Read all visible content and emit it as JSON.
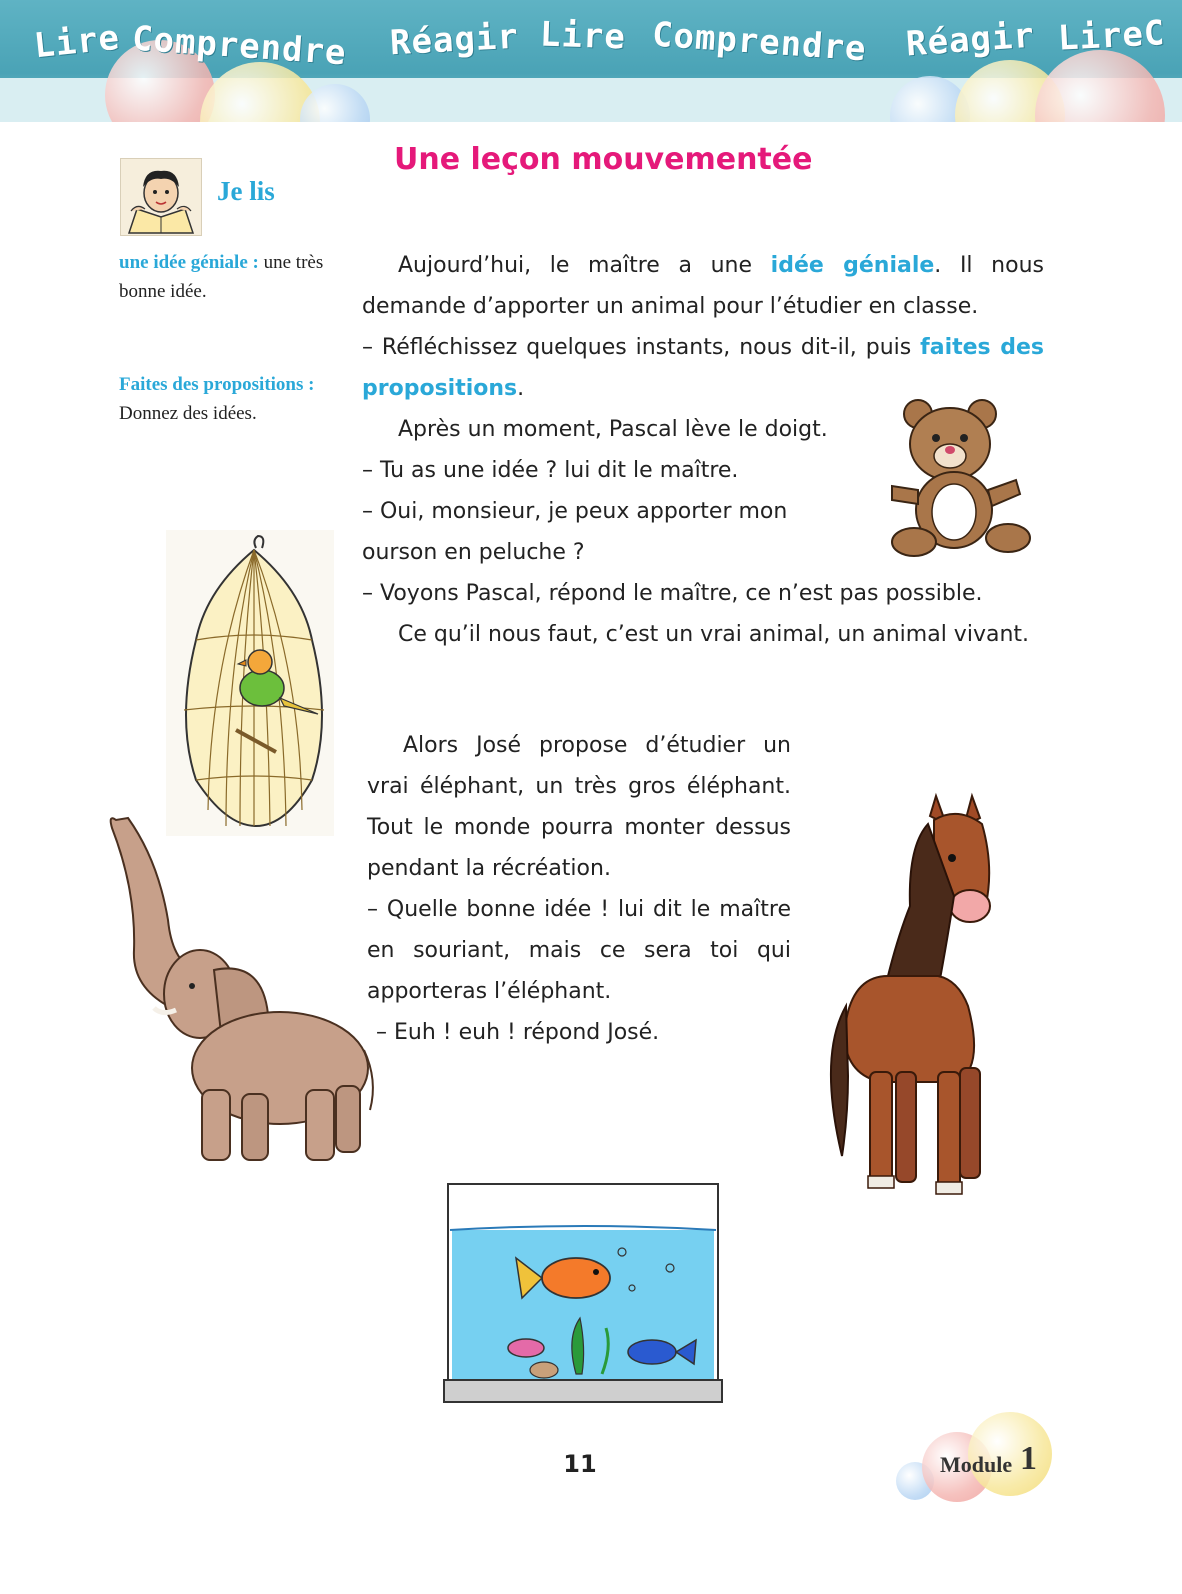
{
  "banner": {
    "words": [
      "Lire",
      "Comprendre",
      "Réagir",
      "Lire",
      "Comprendre",
      "Réagir",
      "LireC"
    ]
  },
  "title": "Une leçon mouvementée",
  "sidebar": {
    "section_label": "Je lis",
    "glossary": [
      {
        "term": "une idée géniale :",
        "definition": "une très bonne idée."
      },
      {
        "term": "Faites des propositions :",
        "definition": "Donnez des idées."
      }
    ]
  },
  "story": {
    "p1_before": "Aujourd’hui, le maître a une",
    "p1_highlight": "idée  géniale",
    "p1_after": ". Il nous demande d’apporter un animal pour l’étudier en classe.",
    "p2_before": "– Réfléchissez quelques instants, nous dit-il, puis",
    "p2_highlight": "faites des propositions",
    "p2_after": ".",
    "lines": [
      "Après un moment, Pascal lève le doigt.",
      "– Tu as une idée ? lui dit le maître.",
      "– Oui, monsieur, je peux apporter mon",
      "ourson en peluche ?",
      "– Voyons Pascal, répond le maître, ce n’est pas possible.",
      "Ce qu’il nous faut, c’est un vrai animal, un animal vivant."
    ],
    "p4": "Alors José propose d’étudier un vrai éléphant, un très gros éléphant. Tout le monde pourra monter dessus pendant la récréation.",
    "p5": "– Quelle bonne idée ! lui dit le maître en souriant, mais ce sera toi qui apporteras l’éléphant.",
    "p6": "– Euh ! euh ! répond José."
  },
  "footer": {
    "page_number": "11",
    "module_label": "Module",
    "module_number": "1"
  },
  "illustrations": [
    "reading-child",
    "teddy-bear",
    "bird-cage",
    "elephant",
    "horse",
    "aquarium"
  ],
  "colors": {
    "title": "#e5197a",
    "highlight": "#2aa8d8",
    "banner": "#4aa3b6"
  }
}
